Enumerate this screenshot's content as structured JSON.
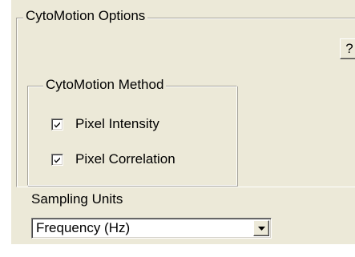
{
  "options_group": {
    "title": "CytoMotion Options",
    "help_label": "?"
  },
  "method_group": {
    "title": "CytoMotion Method",
    "options": [
      {
        "label": "Pixel Intensity",
        "checked": true
      },
      {
        "label": "Pixel Correlation",
        "checked": true
      }
    ]
  },
  "sampling": {
    "label": "Sampling Units",
    "selected": "Frequency (Hz)"
  },
  "icons": {
    "help": "question-mark",
    "check": "check-mark",
    "dropdown": "chevron-down-icon"
  },
  "colors": {
    "panel_background": "#ece9d8",
    "page_background": "#ffffff"
  }
}
